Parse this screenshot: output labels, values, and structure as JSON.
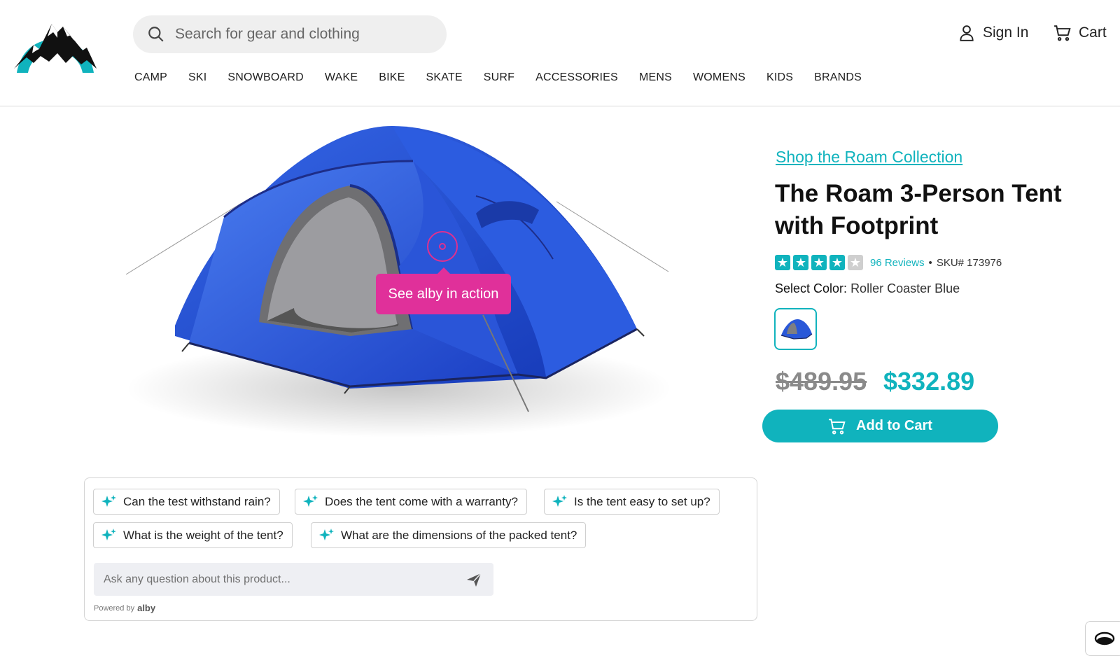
{
  "header": {
    "search": {
      "placeholder": "Search for gear and clothing"
    },
    "sign_in": "Sign In",
    "cart": "Cart"
  },
  "nav": {
    "items": [
      "CAMP",
      "SKI",
      "SNOWBOARD",
      "WAKE",
      "BIKE",
      "SKATE",
      "SURF",
      "ACCESSORIES",
      "MENS",
      "WOMENS",
      "KIDS",
      "BRANDS"
    ]
  },
  "hotspot": {
    "label": "See alby in action"
  },
  "product": {
    "collection_link": "Shop the Roam Collection",
    "title": "The Roam 3-Person Tent with Footprint",
    "rating": 4,
    "rating_max": 5,
    "reviews": "96 Reviews",
    "separator": "•",
    "sku": "SKU# 173976",
    "color_label": "Select Color:",
    "color_value": "Roller Coaster Blue",
    "old_price": "$489.95",
    "new_price": "$332.89",
    "add_to_cart": "Add to Cart"
  },
  "qa": {
    "questions": [
      "Can the test withstand rain?",
      "Does the tent come with a warranty?",
      "Is the tent easy to set up?",
      "What is the weight of the tent?",
      "What are the dimensions of the packed tent?"
    ],
    "ask_placeholder": "Ask any question about this product...",
    "powered_by": "Powered by",
    "powered_brand": "alby"
  },
  "colors": {
    "accent": "#10b3bd",
    "hotspot": "#e0309a",
    "star_filled": "#10b3bd",
    "star_empty": "#cfcfcf",
    "tent_blue": "#1f4fd6"
  },
  "icons": [
    "mountain-logo-icon",
    "search-icon",
    "user-icon",
    "cart-icon",
    "sparkle-icon",
    "send-icon",
    "chat-widget-icon"
  ]
}
